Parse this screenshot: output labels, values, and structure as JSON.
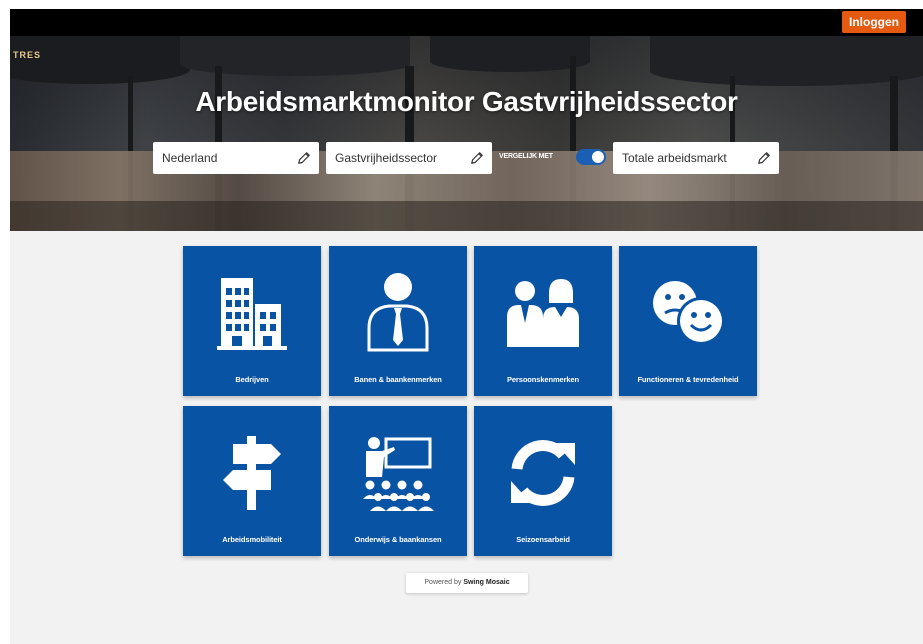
{
  "header": {
    "login_label": "Inloggen"
  },
  "hero": {
    "brand_sign": "TRES",
    "title": "Arbeidsmarktmonitor Gastvrijheidssector",
    "filters": {
      "region": "Nederland",
      "sector": "Gastvrijheidssector",
      "compare_label": "VERGELIJK MET",
      "compare_value": "Totale arbeidsmarkt"
    },
    "compare_toggle_on": true
  },
  "tiles": [
    {
      "label": "Bedrijven",
      "icon": "buildings-icon"
    },
    {
      "label": "Banen & baankenmerken",
      "icon": "person-tie-icon"
    },
    {
      "label": "Persoonskenmerken",
      "icon": "people-icon"
    },
    {
      "label": "Functioneren & tevredenheid",
      "icon": "smiley-faces-icon"
    },
    {
      "label": "Arbeidsmobiliteit",
      "icon": "signpost-icon"
    },
    {
      "label": "Onderwijs & baankansen",
      "icon": "classroom-icon"
    },
    {
      "label": "Seizoensarbeid",
      "icon": "refresh-arrows-icon"
    }
  ],
  "footer": {
    "powered_prefix": "Powered by",
    "powered_brand": "Swing Mosaic"
  },
  "colors": {
    "tile_blue": "#0953a4",
    "login_orange": "#e35a10",
    "toggle_blue": "#1a5fb4"
  }
}
